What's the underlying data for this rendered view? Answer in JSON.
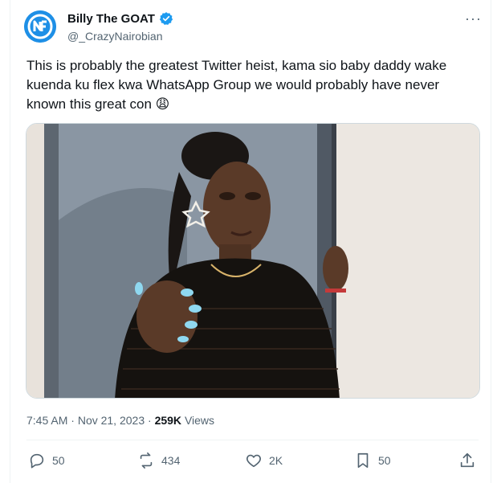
{
  "tweet": {
    "display_name": "Billy The GOAT",
    "handle": "@_CrazyNairobian",
    "text": "This is probably the greatest Twitter heist, kama sio baby daddy wake kuenda ku flex kwa WhatsApp Group we would probably have never known this great con 😩",
    "time": "7:45 AM",
    "separator": "·",
    "date": "Nov 21, 2023",
    "views_count": "259K",
    "views_label": "Views"
  },
  "actions": {
    "replies": "50",
    "reposts": "434",
    "likes": "2K",
    "bookmarks": "50"
  },
  "colors": {
    "accent": "#1d9bf0",
    "secondary_text": "#536471",
    "avatar_bg": "#1e8fe6",
    "wall": "#e9e3dc"
  }
}
